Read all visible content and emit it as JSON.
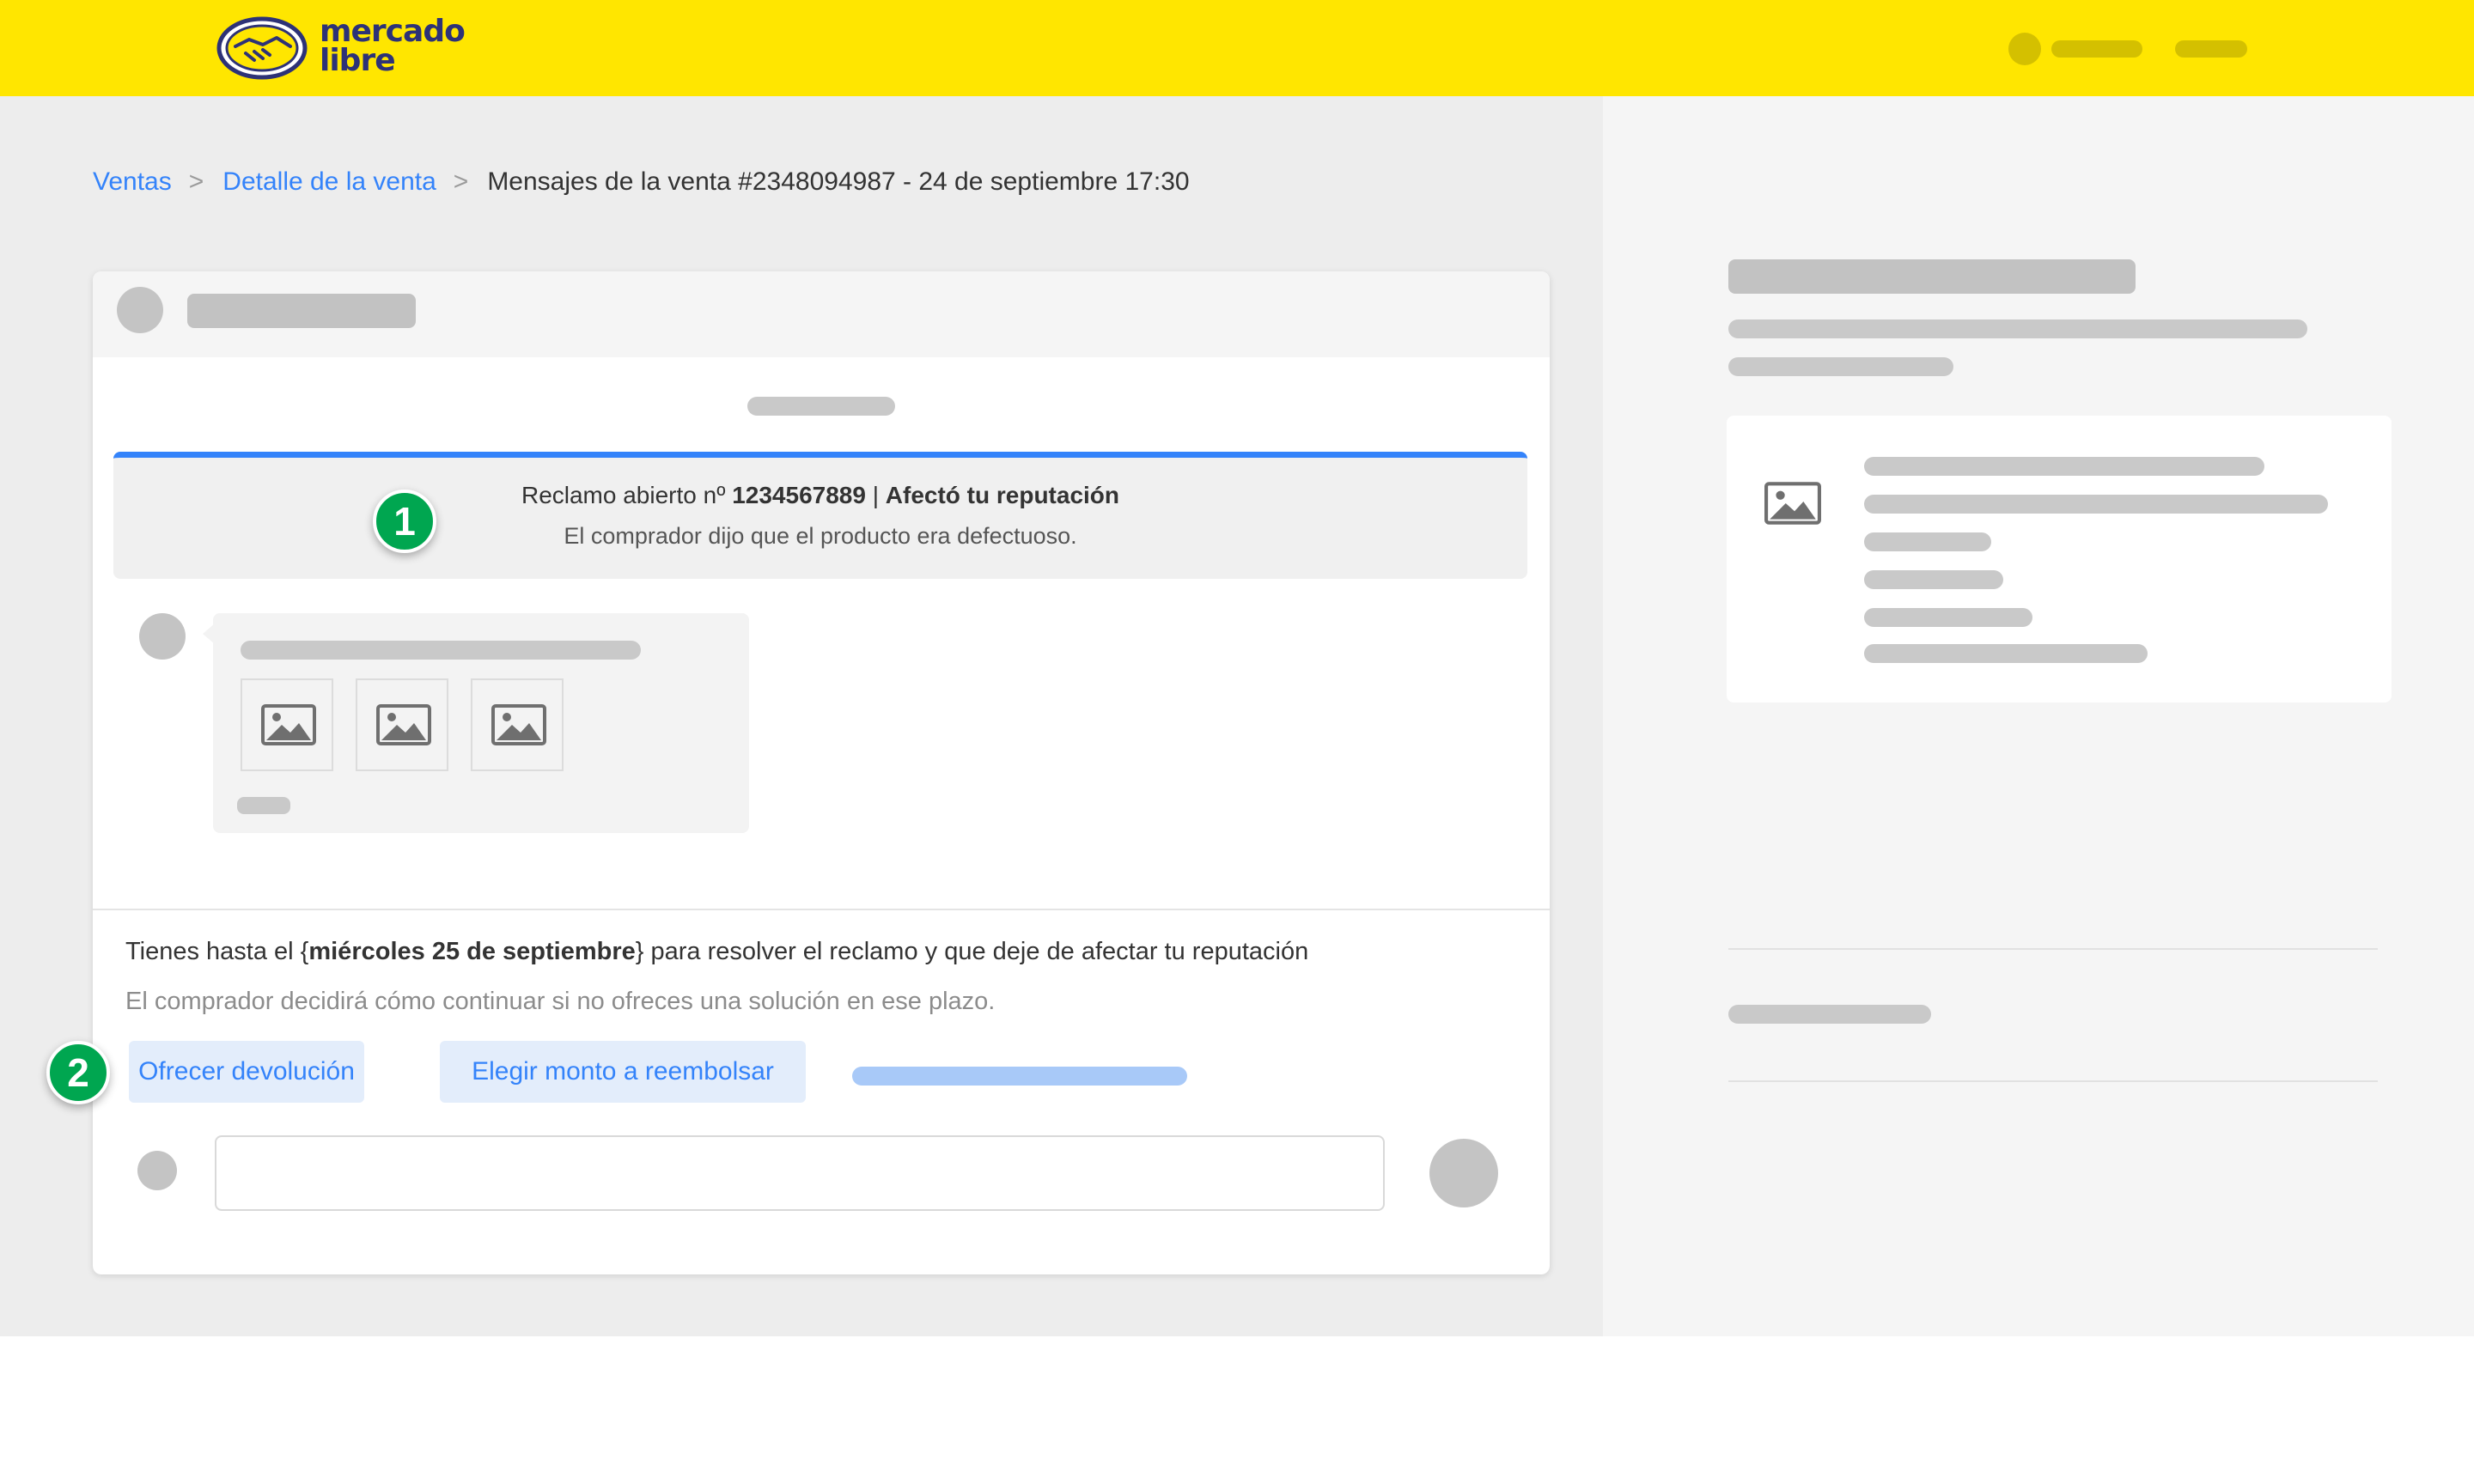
{
  "header": {
    "logo_text": "mercado\nlibre"
  },
  "breadcrumb": {
    "items": [
      "Ventas",
      "Detalle de la venta"
    ],
    "separator": ">",
    "current": "Mensajes de la venta #2348094987 - 24 de septiembre 17:30"
  },
  "claim": {
    "title_prefix": "Reclamo abierto nº ",
    "claim_number": "1234567889",
    "title_separator": " | ",
    "title_suffix": "Afectó tu reputación",
    "description": "El comprador dijo que el producto era defectuoso."
  },
  "resolution": {
    "deadline_prefix": "Tienes hasta el {",
    "deadline_date": "miércoles 25 de septiembre",
    "deadline_suffix": "} para resolver el reclamo y que deje de afectar tu reputación",
    "subtitle": "El comprador decidirá cómo continuar si no ofreces una solución en ese plazo.",
    "buttons": {
      "offer_return": "Ofrecer devolución",
      "choose_refund": "Elegir monto a reembolsar"
    }
  },
  "markers": [
    "1",
    "2"
  ],
  "colors": {
    "brand_yellow": "#ffe600",
    "link_blue": "#3483fa",
    "marker_green": "#00a650",
    "button_bg": "#e3edfb",
    "skeleton_gray": "#c4c4c4"
  }
}
